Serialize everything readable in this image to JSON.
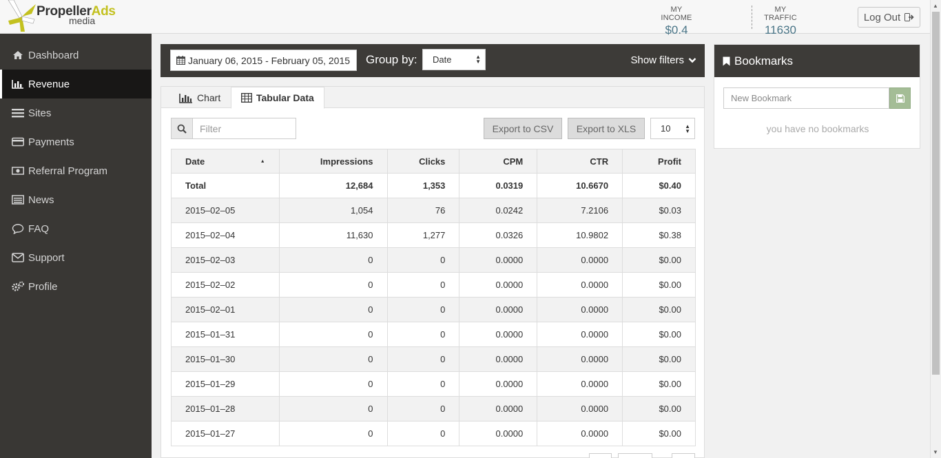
{
  "header": {
    "logo": {
      "brand_main": "Propeller",
      "brand_accent": "Ads",
      "brand_sub": "media"
    },
    "income": {
      "label": "MY INCOME",
      "value": "$0.4"
    },
    "traffic": {
      "label": "MY TRAFFIC",
      "value": "11630"
    },
    "logout_label": "Log Out"
  },
  "sidebar": {
    "items": [
      {
        "label": "Dashboard",
        "icon": "home-icon"
      },
      {
        "label": "Revenue",
        "icon": "bar-chart-icon",
        "active": true
      },
      {
        "label": "Sites",
        "icon": "list-icon"
      },
      {
        "label": "Payments",
        "icon": "credit-card-icon"
      },
      {
        "label": "Referral Program",
        "icon": "money-icon"
      },
      {
        "label": "News",
        "icon": "newspaper-icon"
      },
      {
        "label": "FAQ",
        "icon": "comment-icon"
      },
      {
        "label": "Support",
        "icon": "envelope-icon"
      },
      {
        "label": "Profile",
        "icon": "gears-icon"
      }
    ]
  },
  "filters": {
    "date_range": "January 06, 2015 - February 05, 2015",
    "group_by_label": "Group by:",
    "group_by_value": "Date",
    "show_filters_label": "Show filters"
  },
  "tabs": {
    "chart": "Chart",
    "tabular": "Tabular Data"
  },
  "toolbar": {
    "filter_placeholder": "Filter",
    "export_csv": "Export to CSV",
    "export_xls": "Export to XLS",
    "per_page": "10"
  },
  "table": {
    "columns": [
      "Date",
      "Impressions",
      "Clicks",
      "CPM",
      "CTR",
      "Profit"
    ],
    "total": [
      "Total",
      "12,684",
      "1,353",
      "0.0319",
      "10.6670",
      "$0.40"
    ],
    "rows": [
      [
        "2015–02–05",
        "1,054",
        "76",
        "0.0242",
        "7.2106",
        "$0.03"
      ],
      [
        "2015–02–04",
        "11,630",
        "1,277",
        "0.0326",
        "10.9802",
        "$0.38"
      ],
      [
        "2015–02–03",
        "0",
        "0",
        "0.0000",
        "0.0000",
        "$0.00"
      ],
      [
        "2015–02–02",
        "0",
        "0",
        "0.0000",
        "0.0000",
        "$0.00"
      ],
      [
        "2015–02–01",
        "0",
        "0",
        "0.0000",
        "0.0000",
        "$0.00"
      ],
      [
        "2015–01–31",
        "0",
        "0",
        "0.0000",
        "0.0000",
        "$0.00"
      ],
      [
        "2015–01–30",
        "0",
        "0",
        "0.0000",
        "0.0000",
        "$0.00"
      ],
      [
        "2015–01–29",
        "0",
        "0",
        "0.0000",
        "0.0000",
        "$0.00"
      ],
      [
        "2015–01–28",
        "0",
        "0",
        "0.0000",
        "0.0000",
        "$0.00"
      ],
      [
        "2015–01–27",
        "0",
        "0",
        "0.0000",
        "0.0000",
        "$0.00"
      ]
    ]
  },
  "bookmarks": {
    "title": "Bookmarks",
    "input_placeholder": "New Bookmark",
    "empty_text": "you have no bookmarks"
  },
  "colors": {
    "sidebar_bg": "#393734",
    "sidebar_active_bg": "#181716",
    "panel_header_bg": "#3d3b38",
    "brand_accent": "#c3c11f",
    "stat_value": "#4a7587",
    "save_button": "#a4bd96"
  }
}
